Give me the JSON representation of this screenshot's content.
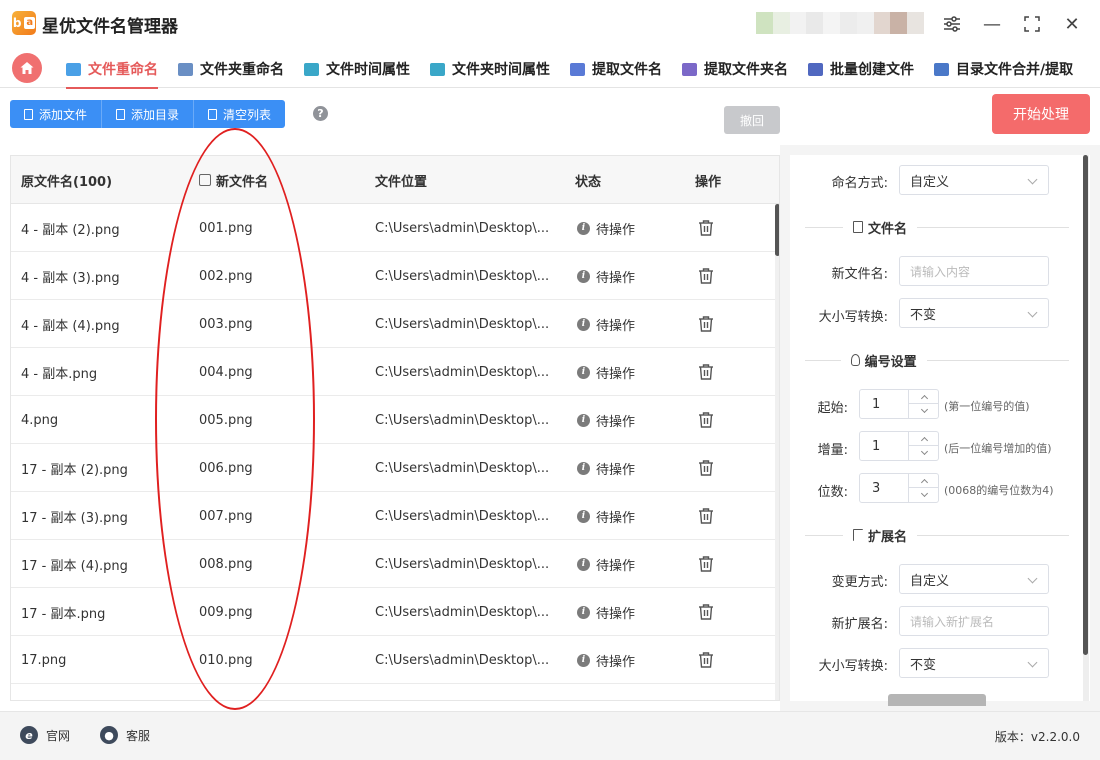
{
  "app": {
    "logo_text": "a",
    "title": "星优文件名管理器"
  },
  "window_controls": {
    "settings_icon": "sliders-icon",
    "minimize": "—",
    "maximize": "⛶",
    "close": "✕"
  },
  "tabs": [
    {
      "label": "文件重命名",
      "active": true,
      "icon_color": "#4aa0e6"
    },
    {
      "label": "文件夹重命名",
      "active": false,
      "icon_color": "#6a8fc4"
    },
    {
      "label": "文件时间属性",
      "active": false,
      "icon_color": "#3aa7c8"
    },
    {
      "label": "文件夹时间属性",
      "active": false,
      "icon_color": "#3aa7c8"
    },
    {
      "label": "提取文件名",
      "active": false,
      "icon_color": "#5a7ad6"
    },
    {
      "label": "提取文件夹名",
      "active": false,
      "icon_color": "#7b68c8"
    },
    {
      "label": "批量创建文件",
      "active": false,
      "icon_color": "#5068c0"
    },
    {
      "label": "目录文件合并/提取",
      "active": false,
      "icon_color": "#4a78c8"
    }
  ],
  "toolbar": {
    "add_file": "添加文件",
    "add_dir": "添加目录",
    "clear_list": "清空列表",
    "help": "?",
    "undo": "撤回",
    "start": "开始处理"
  },
  "table": {
    "headers": {
      "original": "原文件名(100)",
      "new_name": "新文件名",
      "location": "文件位置",
      "status": "状态",
      "action": "操作"
    },
    "rows": [
      {
        "original": "4 - 副本 (2).png",
        "new_name": "001.png",
        "location": "C:\\Users\\admin\\Desktop\\...",
        "status": "待操作"
      },
      {
        "original": "4 - 副本 (3).png",
        "new_name": "002.png",
        "location": "C:\\Users\\admin\\Desktop\\...",
        "status": "待操作"
      },
      {
        "original": "4 - 副本 (4).png",
        "new_name": "003.png",
        "location": "C:\\Users\\admin\\Desktop\\...",
        "status": "待操作"
      },
      {
        "original": "4 - 副本.png",
        "new_name": "004.png",
        "location": "C:\\Users\\admin\\Desktop\\...",
        "status": "待操作"
      },
      {
        "original": "4.png",
        "new_name": "005.png",
        "location": "C:\\Users\\admin\\Desktop\\...",
        "status": "待操作"
      },
      {
        "original": "17 - 副本 (2).png",
        "new_name": "006.png",
        "location": "C:\\Users\\admin\\Desktop\\...",
        "status": "待操作"
      },
      {
        "original": "17 - 副本 (3).png",
        "new_name": "007.png",
        "location": "C:\\Users\\admin\\Desktop\\...",
        "status": "待操作"
      },
      {
        "original": "17 - 副本 (4).png",
        "new_name": "008.png",
        "location": "C:\\Users\\admin\\Desktop\\...",
        "status": "待操作"
      },
      {
        "original": "17 - 副本.png",
        "new_name": "009.png",
        "location": "C:\\Users\\admin\\Desktop\\...",
        "status": "待操作"
      },
      {
        "original": "17.png",
        "new_name": "010.png",
        "location": "C:\\Users\\admin\\Desktop\\...",
        "status": "待操作"
      }
    ]
  },
  "panel": {
    "naming_mode_label": "命名方式:",
    "naming_mode_value": "自定义",
    "section_filename": "文件名",
    "new_name_label": "新文件名:",
    "new_name_placeholder": "请输入内容",
    "case_label": "大小写转换:",
    "case_value": "不变",
    "section_numbering": "编号设置",
    "start_label": "起始:",
    "start_value": "1",
    "start_hint": "(第一位编号的值)",
    "inc_label": "增量:",
    "inc_value": "1",
    "inc_hint": "(后一位编号增加的值)",
    "digits_label": "位数:",
    "digits_value": "3",
    "digits_hint": "(0068的编号位数为4)",
    "section_ext": "扩展名",
    "change_mode_label": "变更方式:",
    "change_mode_value": "自定义",
    "new_ext_label": "新扩展名:",
    "new_ext_placeholder": "请输入新扩展名",
    "ext_case_label": "大小写转换:",
    "ext_case_value": "不变"
  },
  "footer": {
    "website": "官网",
    "support": "客服",
    "version": "版本：v2.2.0.0"
  },
  "colors": {
    "accent_red": "#e55a5a",
    "button_blue": "#3b8ff5",
    "start_button": "#f46b6b",
    "annotation": "#e02020"
  }
}
